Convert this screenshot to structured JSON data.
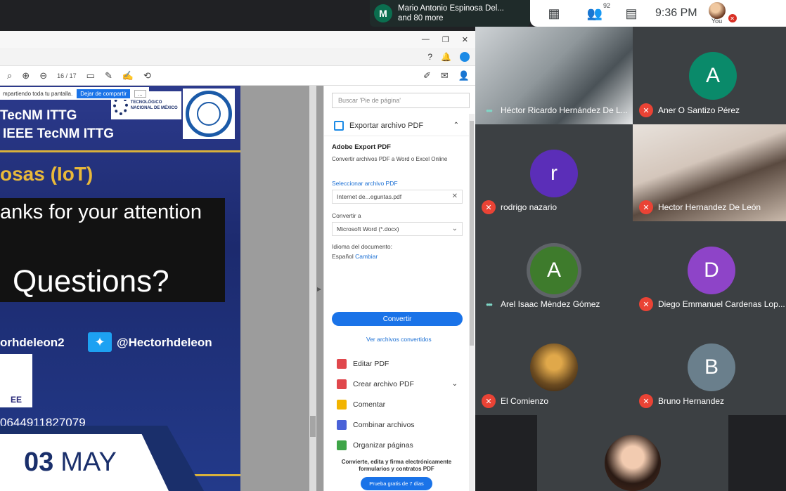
{
  "top": {
    "presenter_initial": "M",
    "presenter_line1": "Mario Antonio Espinosa Del...",
    "presenter_line2": "and 80 more",
    "participants_count": "92",
    "clock": "9:36 PM",
    "you_label": "You"
  },
  "acrobat": {
    "page_current": "16",
    "page_total": "/ 17",
    "sharing_text": "mpartiendo toda tu pantalla.",
    "stop_sharing": "Dejar de compartir",
    "more": "...",
    "search_placeholder": "Buscar 'Pie de página'",
    "export_header": "Exportar archivo PDF",
    "export_title": "Adobe Export PDF",
    "export_desc": "Convertir archivos PDF a Word o Excel Online",
    "select_file_link": "Seleccionar archivo PDF",
    "selected_file": "Internet de...eguntas.pdf",
    "convert_to_label": "Convertir a",
    "convert_to_value": "Microsoft Word (*.docx)",
    "doc_lang_label": "Idioma del documento:",
    "doc_lang_value": "Español",
    "doc_lang_change": "Cambiar",
    "convert_button": "Convertir",
    "view_converted": "Ver archivos convertidos",
    "tools": [
      {
        "label": "Editar PDF",
        "color": "#e0474c"
      },
      {
        "label": "Crear archivo PDF",
        "color": "#e0474c"
      },
      {
        "label": "Comentar",
        "color": "#f2b400"
      },
      {
        "label": "Combinar archivos",
        "color": "#4a62d8"
      },
      {
        "label": "Organizar páginas",
        "color": "#3fa548"
      }
    ],
    "promo_line1": "Convierte, edita y firma electrónicamente",
    "promo_line2": "formularios y contratos PDF",
    "promo_button": "Prueba gratis de 7 días"
  },
  "slide": {
    "line1": "TecNM ITTG",
    "line2": "IEEE TecNM ITTG",
    "iot": "osas (IoT)",
    "thanks": "anks for your attention",
    "questions": "Questions?",
    "handle_left": "orhdeleon2",
    "handle_twitter": "@Hectorhdeleon",
    "ieee_text": "EE",
    "phone": "0644911827079",
    "tec_logo_text": "TECNOLÓGICO NACIONAL DE MÉXICO"
  },
  "date": {
    "day": "03",
    "month": "MAY"
  },
  "participants": [
    {
      "name": "Héctor Ricardo Hernández De L...",
      "status": "speaking",
      "type": "video"
    },
    {
      "name": "Aner O Santizo Pérez",
      "status": "muted",
      "initial": "A",
      "color": "#0a8a6a"
    },
    {
      "name": "rodrigo nazario",
      "status": "muted",
      "initial": "r",
      "color": "#5b2eb8"
    },
    {
      "name": "Hector Hernandez De León",
      "status": "muted",
      "type": "video"
    },
    {
      "name": "Arel Isaac Mèndez Gómez",
      "status": "speaking",
      "initial": "A",
      "color": "#3e7b2c"
    },
    {
      "name": "Diego Emmanuel Cardenas Lop...",
      "status": "muted",
      "initial": "D",
      "color": "#8e44c8"
    },
    {
      "name": "El Comienzo",
      "status": "muted",
      "type": "image"
    },
    {
      "name": "Bruno Hernandez",
      "status": "muted",
      "initial": "B",
      "color": "#6a7f8c"
    }
  ]
}
